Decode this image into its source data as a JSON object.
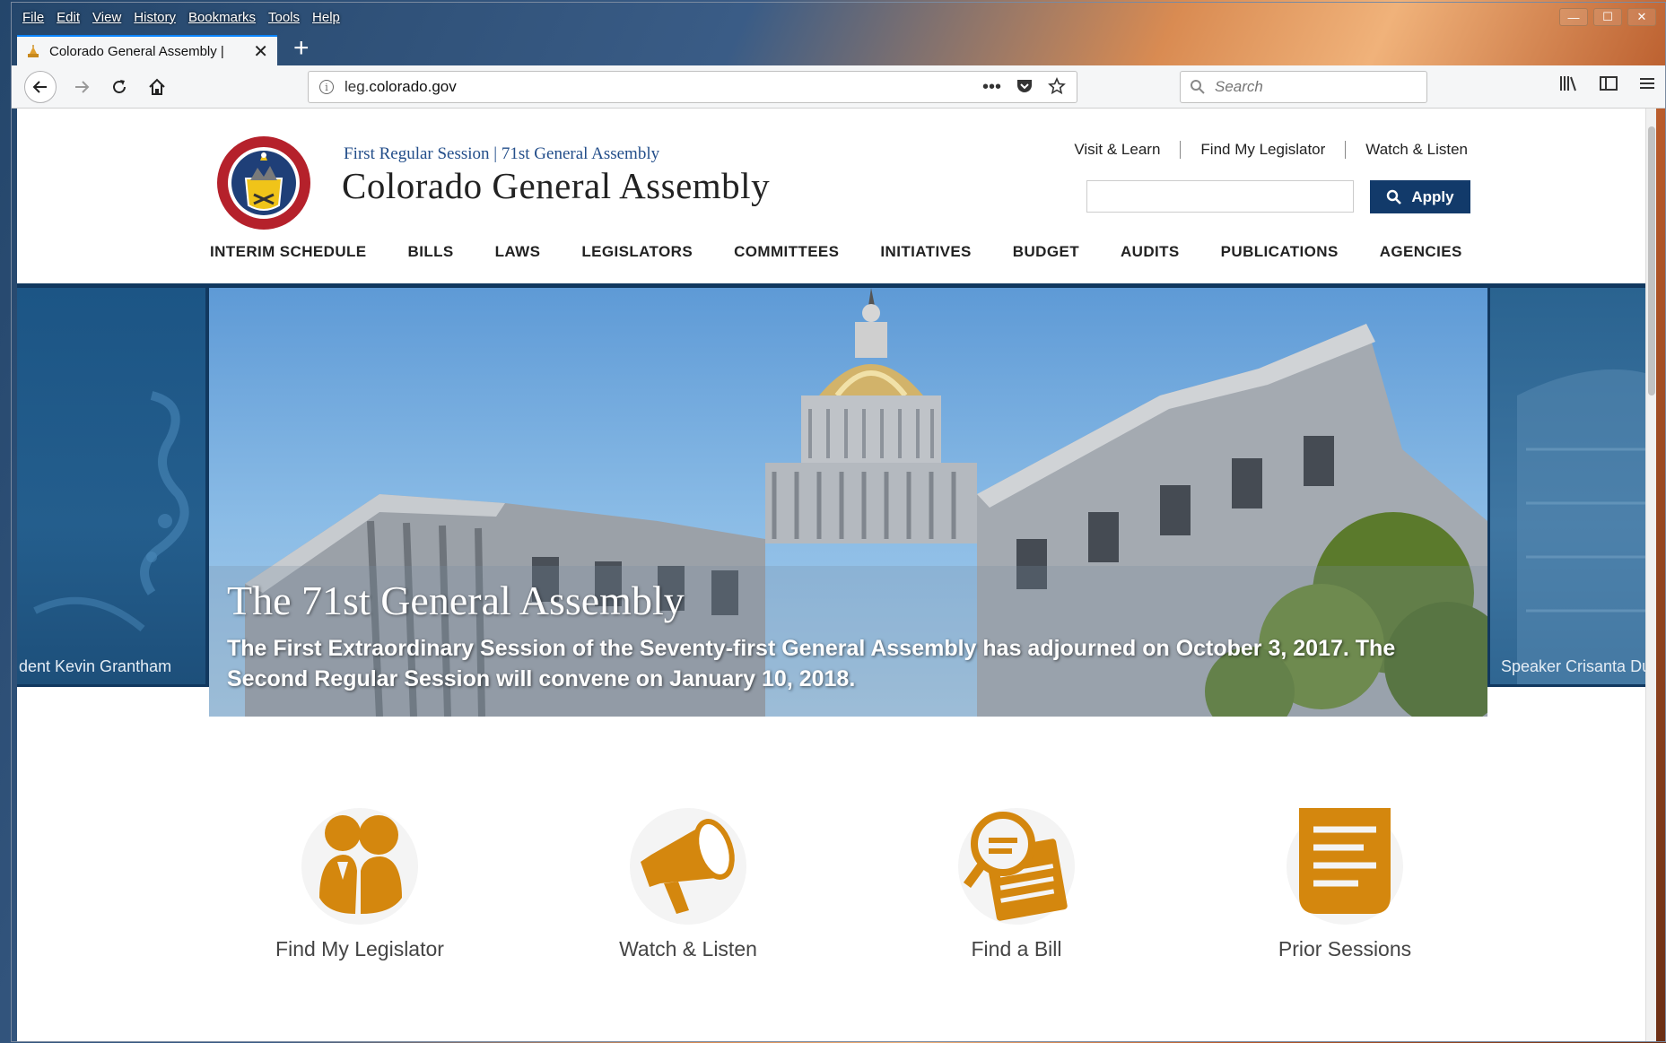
{
  "menubar": [
    "File",
    "Edit",
    "View",
    "History",
    "Bookmarks",
    "Tools",
    "Help"
  ],
  "tab": {
    "title": "Colorado General Assembly |",
    "close": "✕",
    "new": "+"
  },
  "urlbar": {
    "host_prefix": "leg.",
    "host_main": "colorado.gov",
    "actions": "•••"
  },
  "search": {
    "placeholder": "Search"
  },
  "site": {
    "session": "First Regular Session | 71st General Assembly",
    "name": "Colorado General Assembly",
    "top_links": [
      "Visit & Learn",
      "Find My Legislator",
      "Watch & Listen"
    ],
    "apply_label": "Apply",
    "nav": [
      "INTERIM SCHEDULE",
      "BILLS",
      "LAWS",
      "LEGISLATORS",
      "COMMITTEES",
      "INITIATIVES",
      "BUDGET",
      "AUDITS",
      "PUBLICATIONS",
      "AGENCIES"
    ]
  },
  "carousel": {
    "left_caption": "dent Kevin Grantham",
    "right_caption": "Speaker Crisanta Dur",
    "title": "The 71st General Assembly",
    "subtitle": "The First Extraordinary Session of the Seventy-first General Assembly has adjourned on October 3, 2017. The Second Regular Session will convene on January 10, 2018."
  },
  "features": [
    "Find My Legislator",
    "Watch & Listen",
    "Find a Bill",
    "Prior Sessions"
  ],
  "colors": {
    "accent": "#d4870e",
    "navy": "#123a6a",
    "link_blue": "#234e8a"
  }
}
